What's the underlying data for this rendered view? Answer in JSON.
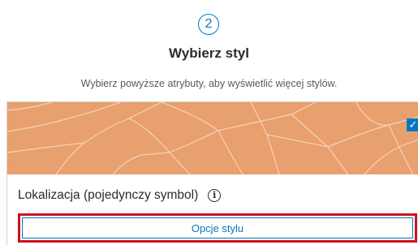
{
  "step": {
    "number": "2",
    "title": "Wybierz styl",
    "description": "Wybierz powyższe atrybuty, aby wyświetlić więcej stylów."
  },
  "style_card": {
    "name": "Lokalizacja (pojedynczy symbol)",
    "selected": true,
    "fill_color": "#e8a06e",
    "line_color": "#f6d2b8",
    "checkbox_icon": "checkmark-icon",
    "info_icon": "info-icon",
    "options_button_label": "Opcje stylu"
  },
  "colors": {
    "accent": "#007ac2",
    "highlight": "#d0101c"
  }
}
